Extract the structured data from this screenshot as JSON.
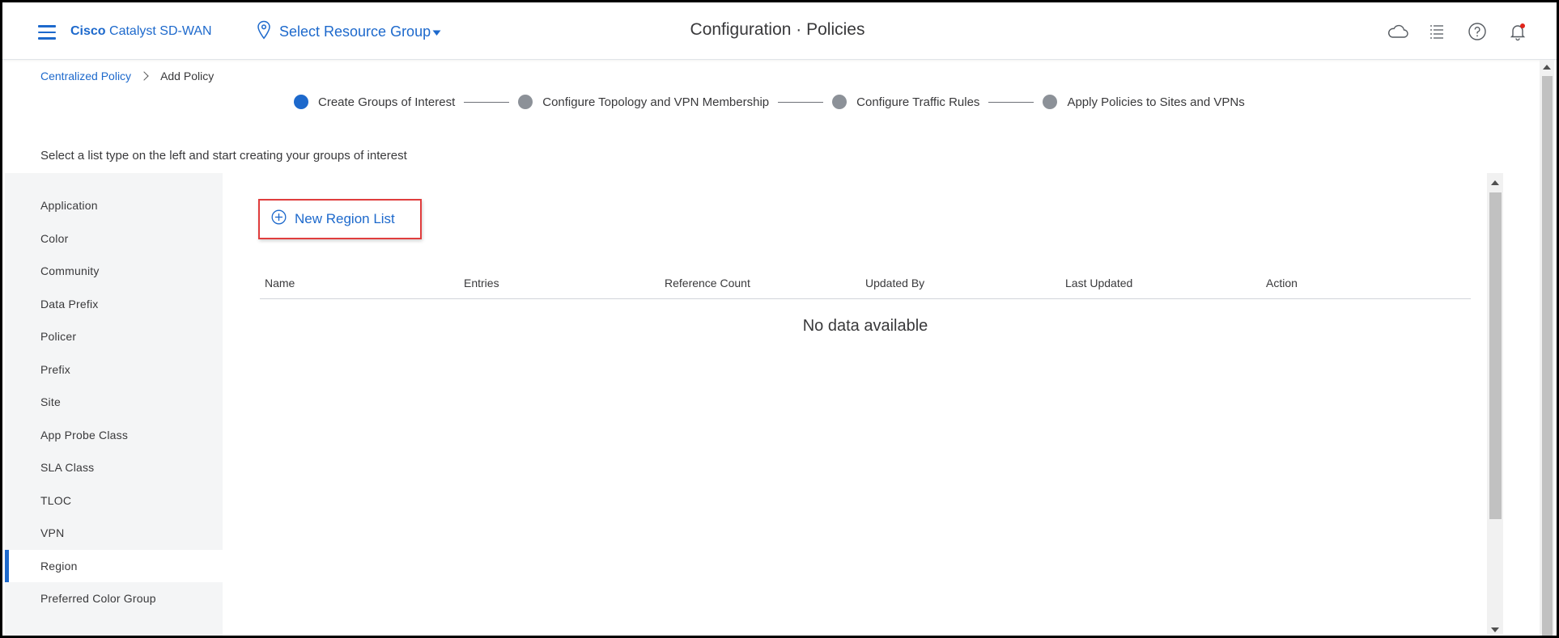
{
  "header": {
    "brand_bold": "Cisco",
    "brand_rest": " Catalyst SD-WAN",
    "resource_group": "Select Resource Group",
    "title": "Configuration · Policies",
    "icons": [
      "cloud-icon",
      "task-list-icon",
      "help-icon",
      "notification-bell-icon"
    ],
    "notification_color": "#e2231a"
  },
  "breadcrumb": {
    "parent": "Centralized Policy",
    "current": "Add Policy"
  },
  "stepper": {
    "steps": [
      {
        "label": "Create Groups of Interest",
        "active": true
      },
      {
        "label": "Configure Topology and VPN Membership",
        "active": false
      },
      {
        "label": "Configure Traffic Rules",
        "active": false
      },
      {
        "label": "Apply Policies to Sites and VPNs",
        "active": false
      }
    ]
  },
  "instructions": "Select a list type on the left and start creating your groups of interest",
  "sidebar": {
    "items": [
      {
        "label": "Application"
      },
      {
        "label": "Color"
      },
      {
        "label": "Community"
      },
      {
        "label": "Data Prefix"
      },
      {
        "label": "Policer"
      },
      {
        "label": "Prefix"
      },
      {
        "label": "Site"
      },
      {
        "label": "App Probe Class"
      },
      {
        "label": "SLA Class"
      },
      {
        "label": "TLOC"
      },
      {
        "label": "VPN"
      },
      {
        "label": "Region",
        "active": true
      },
      {
        "label": "Preferred Color Group"
      }
    ]
  },
  "main": {
    "new_button": "New Region List",
    "columns": [
      "Name",
      "Entries",
      "Reference Count",
      "Updated By",
      "Last Updated",
      "Action"
    ],
    "empty_text": "No data available"
  },
  "colors": {
    "accent": "#1d69cc",
    "highlight_box": "#e03d3d",
    "inactive_step": "#8c9198"
  }
}
